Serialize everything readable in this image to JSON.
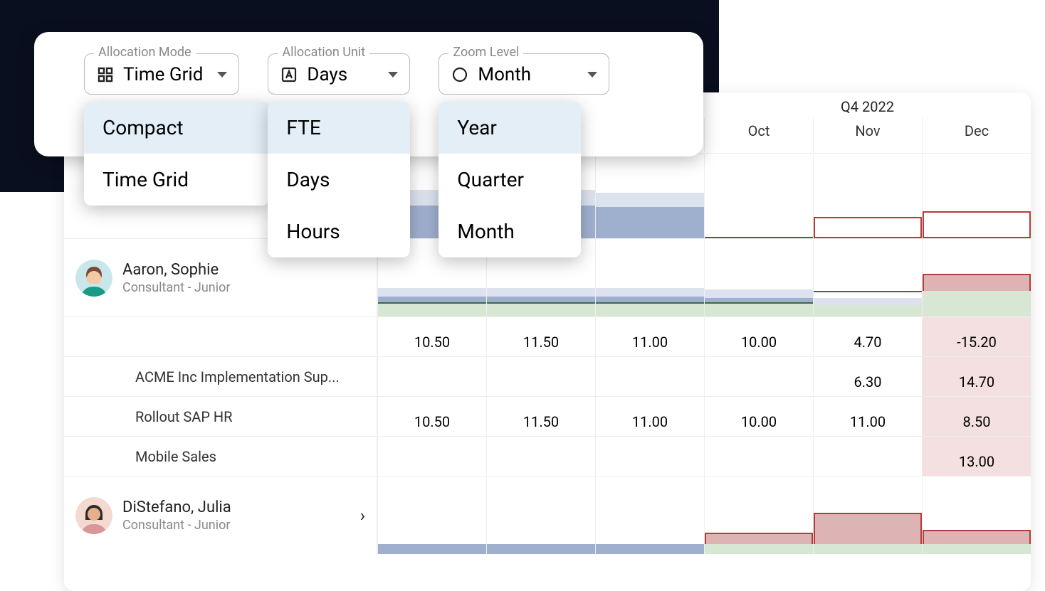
{
  "toolbar": {
    "allocation_mode": {
      "legend": "Allocation Mode",
      "value": "Time Grid",
      "options": [
        "Compact",
        "Time Grid"
      ]
    },
    "allocation_unit": {
      "legend": "Allocation Unit",
      "value": "Days",
      "options": [
        "FTE",
        "Days",
        "Hours"
      ]
    },
    "zoom_level": {
      "legend": "Zoom Level",
      "value": "Month",
      "options": [
        "Year",
        "Quarter",
        "Month"
      ]
    }
  },
  "timeline": {
    "quarter": "Q4 2022",
    "months": [
      "Oct",
      "Nov",
      "Dec"
    ]
  },
  "people": [
    {
      "name": "Aaron, Sophie",
      "role": "Consultant - Junior",
      "avatar_colors": {
        "bg": "#c9e7ea",
        "hair": "#7a4a3a",
        "shirt": "#1a9b8a",
        "skin": "#f3c9a6"
      },
      "summary": [
        "10.50",
        "11.50",
        "11.00",
        "10.00",
        "4.70",
        "-15.20"
      ],
      "tasks": [
        {
          "label": "ACME Inc Implementation Sup...",
          "values": [
            "",
            "",
            "",
            "",
            "6.30",
            "14.70"
          ]
        },
        {
          "label": "Rollout SAP HR",
          "values": [
            "10.50",
            "11.50",
            "11.00",
            "10.00",
            "11.00",
            "8.50"
          ]
        },
        {
          "label": "Mobile Sales",
          "values": [
            "",
            "",
            "",
            "",
            "",
            "13.00"
          ]
        }
      ]
    },
    {
      "name": "DiStefano, Julia",
      "role": "Consultant - Junior",
      "avatar_colors": {
        "bg": "#f3d9d0",
        "hair": "#2b2b2b",
        "shirt": "#d99696",
        "skin": "#e6b08a"
      }
    }
  ]
}
